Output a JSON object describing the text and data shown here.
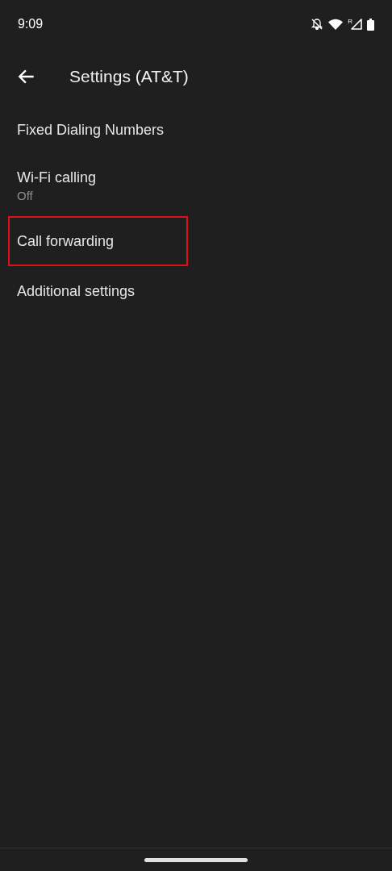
{
  "status_bar": {
    "time": "9:09",
    "roaming_indicator": "R"
  },
  "toolbar": {
    "title": "Settings (AT&T)"
  },
  "items": [
    {
      "title": "Fixed Dialing Numbers",
      "highlighted": false
    },
    {
      "title": "Wi-Fi calling",
      "summary": "Off",
      "highlighted": false
    },
    {
      "title": "Call forwarding",
      "highlighted": true
    },
    {
      "title": "Additional settings",
      "highlighted": false
    }
  ]
}
